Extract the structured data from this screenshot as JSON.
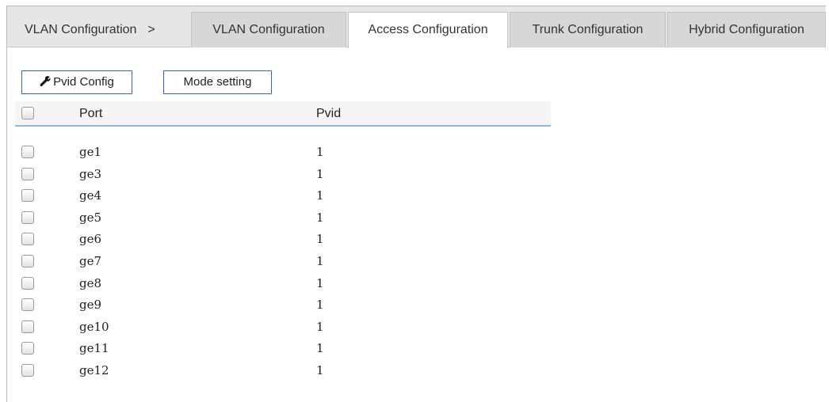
{
  "breadcrumb": {
    "label": "VLAN Configuration",
    "separator": ">"
  },
  "tabs": [
    {
      "label": "VLAN Configuration",
      "active": false
    },
    {
      "label": "Access Configuration",
      "active": true
    },
    {
      "label": "Trunk Configuration",
      "active": false
    },
    {
      "label": "Hybrid Configuration",
      "active": false
    }
  ],
  "toolbar": {
    "pvid_config_label": "Pvid Config",
    "pvid_config_icon": "wrench-icon",
    "mode_setting_label": "Mode setting"
  },
  "table": {
    "columns": [
      "Port",
      "Pvid"
    ],
    "rows": [
      {
        "port": "ge1",
        "pvid": "1"
      },
      {
        "port": "ge3",
        "pvid": "1"
      },
      {
        "port": "ge4",
        "pvid": "1"
      },
      {
        "port": "ge5",
        "pvid": "1"
      },
      {
        "port": "ge6",
        "pvid": "1"
      },
      {
        "port": "ge7",
        "pvid": "1"
      },
      {
        "port": "ge8",
        "pvid": "1"
      },
      {
        "port": "ge9",
        "pvid": "1"
      },
      {
        "port": "ge10",
        "pvid": "1"
      },
      {
        "port": "ge11",
        "pvid": "1"
      },
      {
        "port": "ge12",
        "pvid": "1"
      }
    ]
  },
  "colors": {
    "accent_border": "#3a67a8",
    "header_underline": "#8fb7db",
    "tabbar_bg": "#e6e6e6"
  }
}
